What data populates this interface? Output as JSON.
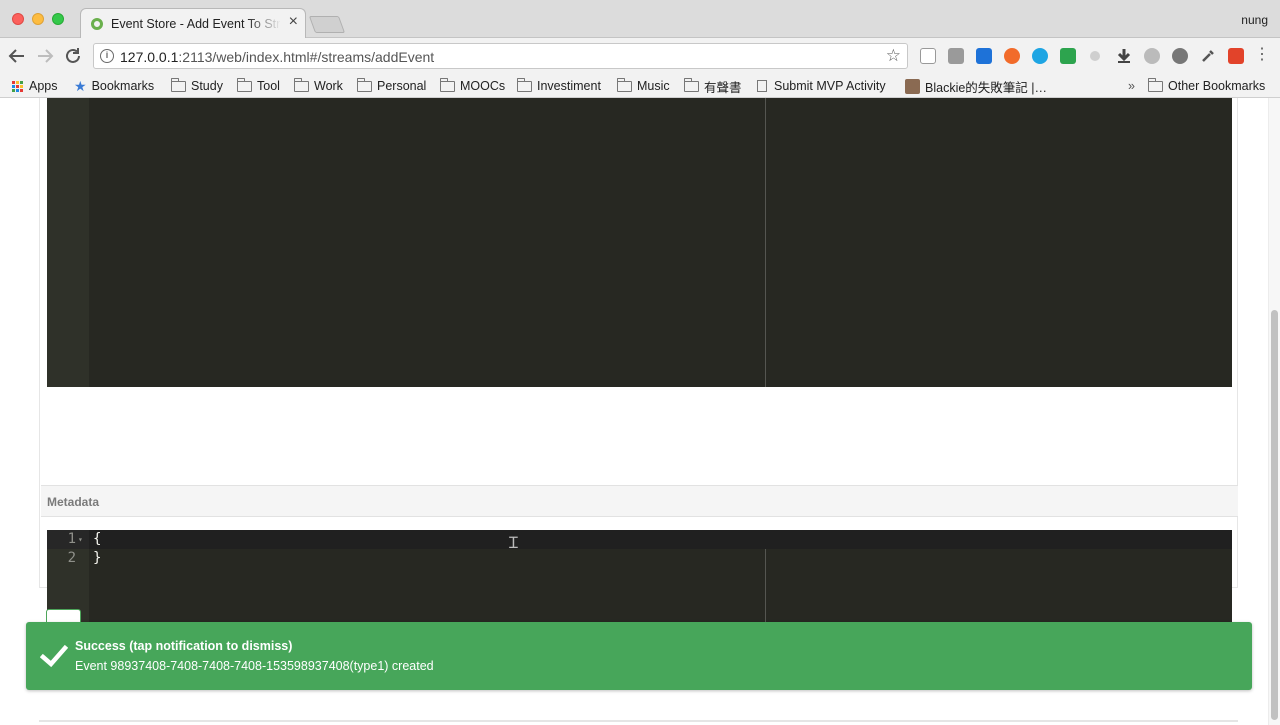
{
  "window": {
    "tab_title": "Event Store - Add Event To Stream",
    "profile_name": "nung"
  },
  "toolbar": {
    "url_host": "127.0.0.1",
    "url_rest": ":2113/web/index.html#/streams/addEvent"
  },
  "bookmarks": {
    "apps": "Apps",
    "bookmarks": "Bookmarks",
    "study": "Study",
    "tool": "Tool",
    "work": "Work",
    "personal": "Personal",
    "moocs": "MOOCs",
    "investiment": "Investiment",
    "music": "Music",
    "audiobooks": "有聲書",
    "submit_mvp": "Submit MVP Activity",
    "blackie": "Blackie的失敗筆記 |…",
    "overflow": "»",
    "other": "Other Bookmarks"
  },
  "metadata": {
    "label": "Metadata",
    "lines": [
      {
        "num": "1",
        "code": "{"
      },
      {
        "num": "2",
        "code": "}"
      }
    ]
  },
  "notification": {
    "title": "Success (tap notification to dismiss)",
    "message": "Event 98937408-7408-7408-7408-153598937408(type1) created",
    "color": "#47a65a"
  },
  "colors": {
    "editor_bg": "#272822",
    "gutter_bg": "#2f3129",
    "accent_green": "#4da55a"
  },
  "icons": {
    "back": "arrow-left-icon",
    "forward": "arrow-right-icon",
    "reload": "reload-icon",
    "info": "info-icon",
    "bookmark_star": "star-icon",
    "menu": "more-vert-icon",
    "check": "checkmark-icon"
  }
}
